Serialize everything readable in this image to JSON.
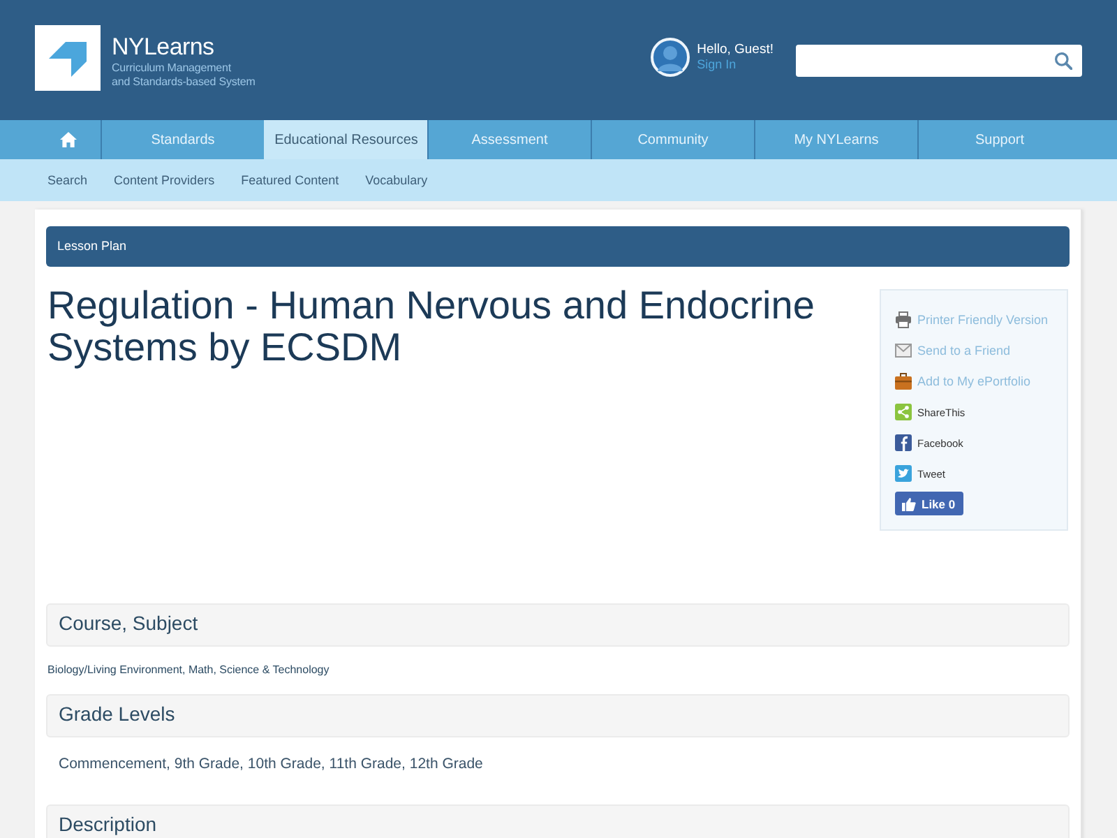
{
  "header": {
    "logo": {
      "name": "NYLearns",
      "tagline": [
        "Curriculum Management",
        "and Standards-based System"
      ]
    },
    "user": {
      "greeting": "Hello, Guest!",
      "link": "Sign In"
    }
  },
  "nav": [
    {
      "kind": "home",
      "selected": false
    },
    {
      "kind": "link",
      "label": "Standards",
      "selected": false
    },
    {
      "kind": "link",
      "label": "Educational Resources",
      "selected": true
    },
    {
      "kind": "link",
      "label": "Assessment",
      "selected": false
    },
    {
      "kind": "link",
      "label": "Community",
      "selected": false
    },
    {
      "kind": "link",
      "label": "My NYLearns",
      "selected": false
    },
    {
      "kind": "link",
      "label": "Support",
      "selected": false
    }
  ],
  "subnav": [
    "Search",
    "Content Providers",
    "Featured Content",
    "Vocabulary"
  ],
  "content": {
    "banner": "Lesson Plan",
    "title": "Regulation - Human Nervous and Endocrine Systems by ECSDM",
    "share_tools": [
      {
        "kind": "printer",
        "label": "Printer Friendly Version"
      },
      {
        "kind": "mail",
        "label": "Send to a Friend"
      },
      {
        "kind": "portfolio",
        "label": "Add to My ePortfolio"
      },
      {
        "kind": "sharethis",
        "label": "ShareThis"
      },
      {
        "kind": "facebook",
        "label": "Facebook"
      },
      {
        "kind": "twitter",
        "label": "Tweet"
      },
      {
        "kind": "like",
        "label": "Like",
        "count": "0"
      }
    ],
    "sections": [
      {
        "kind": "small",
        "heading": "Course, Subject",
        "body": "Biology/Living Environment, Math, Science & Technology"
      },
      {
        "kind": "plain",
        "heading": "Grade Levels",
        "body": "Commencement, 9th Grade, 10th Grade, 11th Grade, 12th Grade"
      },
      {
        "heading": "Description"
      }
    ]
  }
}
